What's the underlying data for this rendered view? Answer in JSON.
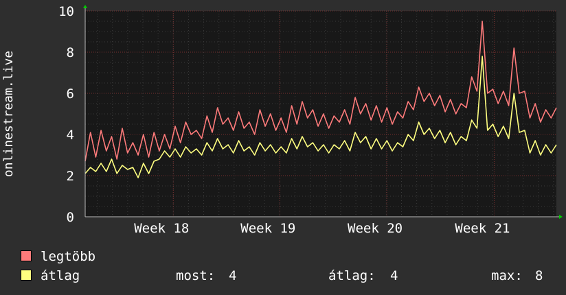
{
  "chart_data": {
    "type": "line",
    "ylabel": "onlinestream.live",
    "ylim": [
      0,
      10
    ],
    "y_ticks": [
      0,
      2,
      4,
      6,
      8,
      10
    ],
    "x_week_ticks": [
      {
        "label": "Week 18",
        "pos": 0.187
      },
      {
        "label": "Week 19",
        "pos": 0.413
      },
      {
        "label": "Week 20",
        "pos": 0.64
      },
      {
        "label": "Week 21",
        "pos": 0.868
      }
    ],
    "grid": true,
    "legend_placement": "bottom-left",
    "series": [
      {
        "name": "legtöbb",
        "color": "#ff7b7b",
        "values": [
          2.7,
          4.1,
          2.9,
          4.2,
          3.2,
          3.9,
          2.8,
          4.3,
          3.1,
          3.6,
          3.0,
          4.0,
          2.9,
          4.1,
          3.2,
          4.0,
          3.3,
          4.4,
          3.6,
          4.6,
          4.0,
          4.2,
          3.8,
          4.9,
          4.1,
          5.3,
          4.5,
          4.8,
          4.2,
          5.1,
          4.3,
          4.6,
          4.0,
          5.2,
          4.4,
          5.0,
          4.2,
          4.8,
          4.1,
          5.4,
          4.5,
          5.6,
          4.8,
          5.2,
          4.4,
          5.0,
          4.3,
          4.9,
          4.6,
          5.2,
          4.5,
          5.8,
          5.0,
          5.5,
          4.7,
          5.4,
          4.6,
          5.3,
          4.5,
          5.1,
          4.8,
          5.6,
          5.2,
          6.3,
          5.6,
          6.0,
          5.4,
          5.9,
          5.1,
          5.7,
          5.0,
          5.5,
          5.3,
          6.8,
          6.1,
          9.5,
          6.0,
          6.2,
          5.5,
          6.1,
          5.4,
          8.2,
          6.0,
          6.1,
          4.8,
          5.5,
          4.6,
          5.2,
          4.8,
          5.3
        ],
        "stats": {
          "now": "4",
          "avg": "4",
          "max": "8"
        }
      },
      {
        "name": "átlag",
        "color": "#ffff80",
        "values": [
          2.1,
          2.4,
          2.2,
          2.6,
          2.2,
          2.8,
          2.1,
          2.5,
          2.3,
          2.4,
          1.9,
          2.6,
          2.1,
          2.7,
          2.8,
          3.2,
          2.9,
          3.3,
          2.9,
          3.4,
          3.1,
          3.3,
          3.0,
          3.6,
          3.2,
          3.8,
          3.3,
          3.5,
          3.1,
          3.7,
          3.2,
          3.4,
          3.0,
          3.6,
          3.2,
          3.5,
          3.1,
          3.4,
          3.1,
          3.8,
          3.3,
          3.9,
          3.4,
          3.6,
          3.2,
          3.5,
          3.1,
          3.5,
          3.3,
          3.7,
          3.2,
          4.1,
          3.6,
          3.9,
          3.3,
          3.8,
          3.3,
          3.7,
          3.2,
          3.6,
          3.4,
          4.0,
          3.7,
          4.6,
          4.0,
          4.3,
          3.8,
          4.2,
          3.6,
          4.1,
          3.5,
          3.9,
          3.7,
          4.7,
          4.3,
          7.8,
          4.2,
          4.5,
          3.9,
          4.4,
          3.8,
          6.0,
          4.1,
          4.2,
          3.1,
          3.7,
          3.0,
          3.5,
          3.1,
          3.5
        ],
        "stats": {
          "now": "4",
          "avg": "4",
          "max": "8"
        }
      }
    ]
  },
  "legend": {
    "max_label": "legtöbb",
    "avg_label": "átlag"
  },
  "stats": {
    "now_label": "most:",
    "now_value": "4",
    "avg_label": "átlag:",
    "avg_value": "4",
    "max_label": "max:",
    "max_value": "8"
  },
  "colors": {
    "background": "#2e2e2e",
    "plot_background": "#181818",
    "grid_minor": "#3a3a3a",
    "grid_major": "#7a2e2e",
    "axis_arrow": "#00cc00"
  }
}
